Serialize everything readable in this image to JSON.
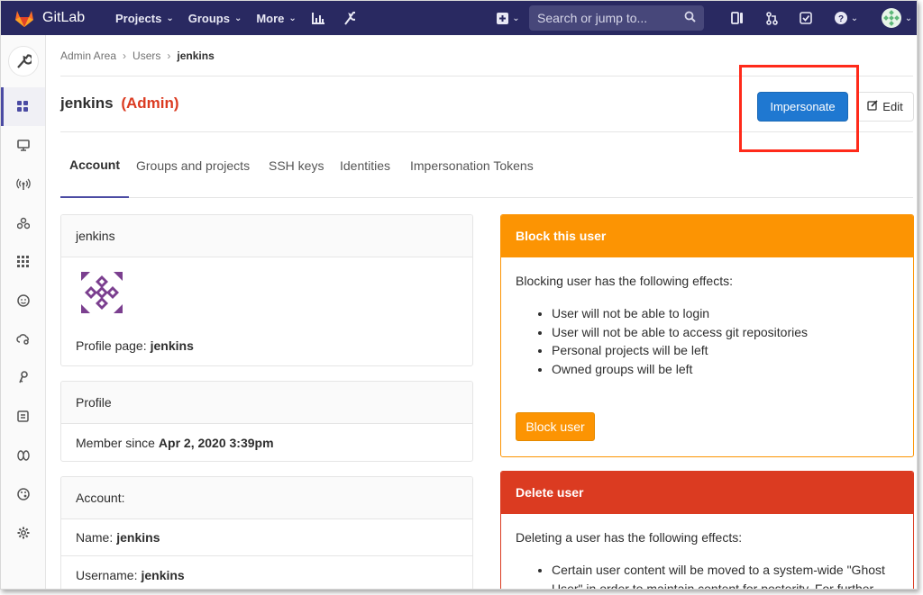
{
  "nav": {
    "brand": "GitLab",
    "items": [
      {
        "label": "Projects"
      },
      {
        "label": "Groups"
      },
      {
        "label": "More"
      }
    ],
    "search_placeholder": "Search or jump to..."
  },
  "breadcrumb": {
    "items": [
      "Admin Area",
      "Users"
    ],
    "current": "jenkins"
  },
  "header": {
    "username": "jenkins",
    "badge": "(Admin)",
    "impersonate_label": "Impersonate",
    "edit_label": "Edit"
  },
  "tabs": [
    {
      "label": "Account",
      "active": true
    },
    {
      "label": "Groups and projects"
    },
    {
      "label": "SSH keys"
    },
    {
      "label": "Identities"
    },
    {
      "label": "Impersonation Tokens"
    }
  ],
  "user_card": {
    "title": "jenkins",
    "profile_label": "Profile page:",
    "profile_value": "jenkins"
  },
  "profile_card": {
    "title": "Profile",
    "member_label": "Member since",
    "member_value": "Apr 2, 2020 3:39pm"
  },
  "account_card": {
    "title": "Account:",
    "name_label": "Name:",
    "name_value": "jenkins",
    "username_label": "Username:",
    "username_value": "jenkins"
  },
  "block_card": {
    "title": "Block this user",
    "intro": "Blocking user has the following effects:",
    "effects": [
      "User will not be able to login",
      "User will not be able to access git repositories",
      "Personal projects will be left",
      "Owned groups will be left"
    ],
    "button": "Block user"
  },
  "delete_card": {
    "title": "Delete user",
    "intro": "Deleting a user has the following effects:",
    "effects": [
      "Certain user content will be moved to a system-wide \"Ghost User\" in order to maintain content for posterity. For further"
    ]
  },
  "colors": {
    "nav_bg": "#292961",
    "primary": "#1f78d1",
    "warning": "#fc9403",
    "danger": "#db3b21",
    "highlight_box": "#ff2a1a"
  }
}
